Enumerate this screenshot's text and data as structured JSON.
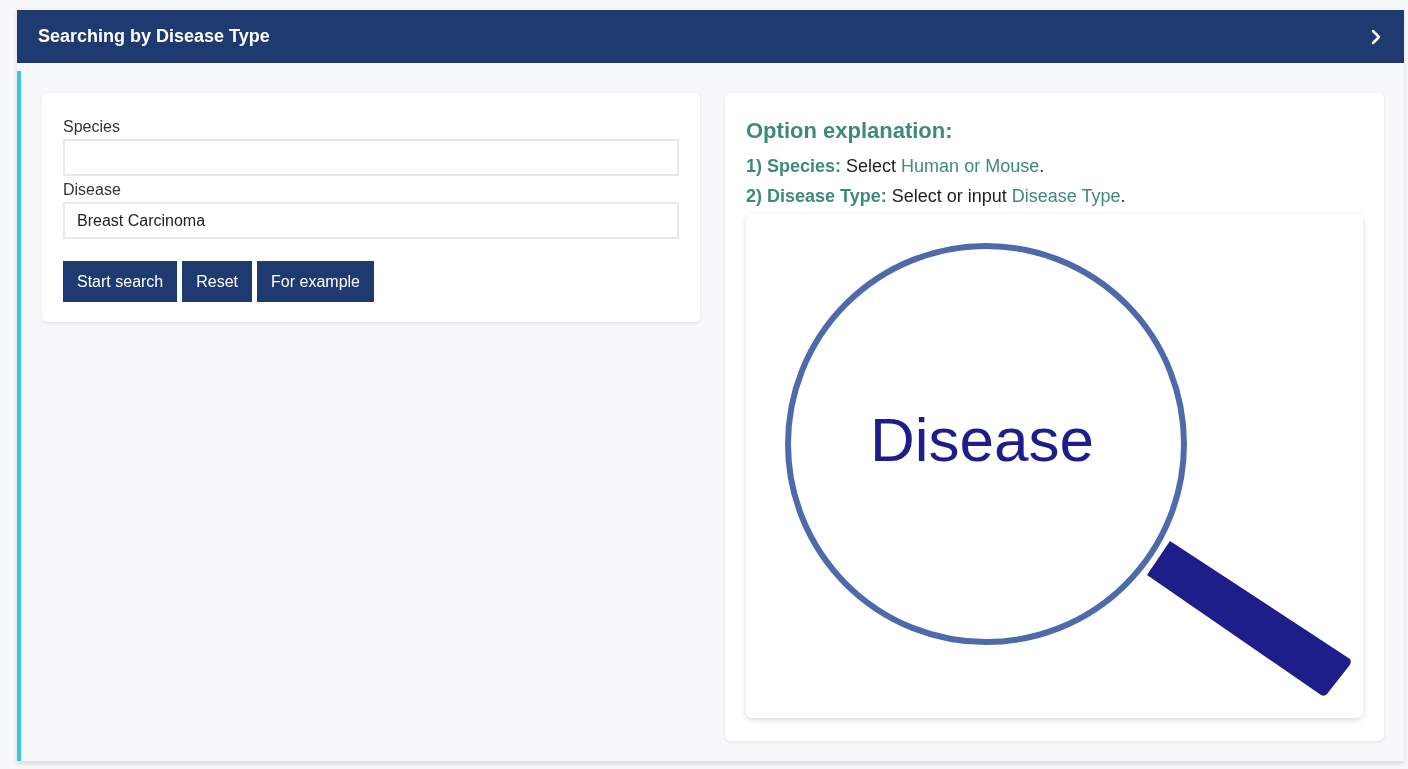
{
  "header": {
    "title": "Searching by Disease Type"
  },
  "search_form": {
    "fields": [
      {
        "label": "Species"
      },
      {
        "label": "Disease",
        "value": "Breast Carcinoma"
      }
    ],
    "buttons": [
      "Start search",
      "Reset",
      "For example"
    ]
  },
  "explanation": {
    "title": "Option explanation:",
    "options": [
      {
        "term": "1) Species:",
        "text": "Select",
        "highlight": "Human or Mouse",
        "end": "."
      },
      {
        "term": "2) Disease Type:",
        "text": "Select or input",
        "highlight": "Disease Type",
        "end": "."
      }
    ]
  },
  "illustration": {
    "label": "Disease"
  }
}
